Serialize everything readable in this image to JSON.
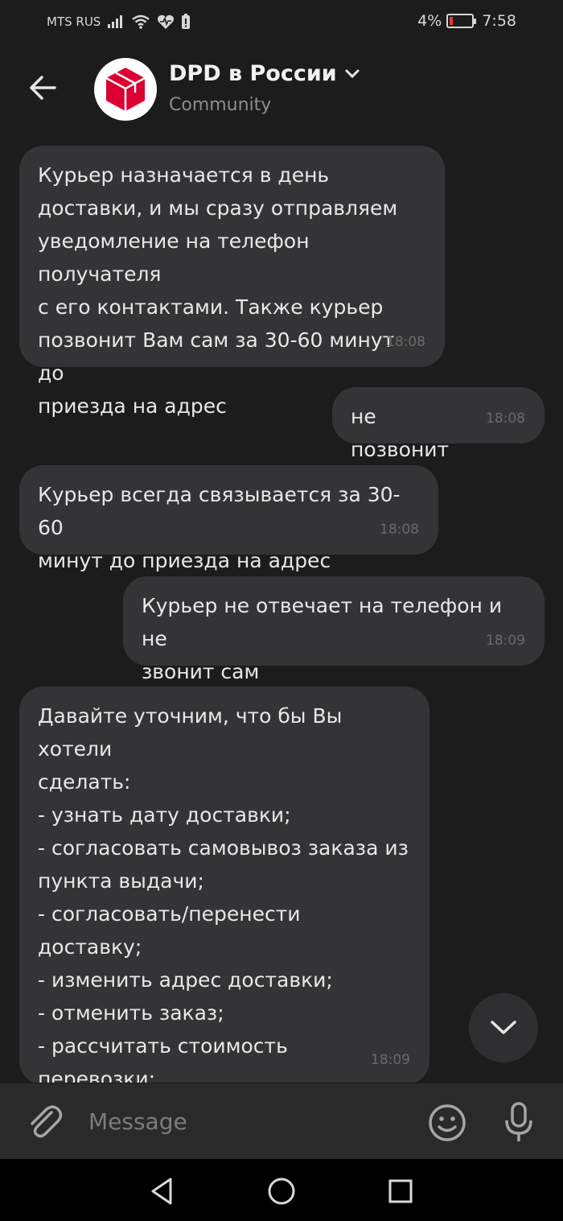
{
  "status": {
    "carrier": "MTS RUS",
    "battery": "4%",
    "time": "7:58",
    "icons": [
      "signal-icon",
      "wifi-icon",
      "health-icon",
      "notification-icon"
    ]
  },
  "header": {
    "title": "DPD в России",
    "subtitle": "Community",
    "brand_color": "#dc0032"
  },
  "messages": [
    {
      "side": "in",
      "text": "Курьер назначается в день\nдоставки, и мы сразу отправляем\nуведомление на телефон получателя\nс его контактами. Также курьер\nпозвонит Вам сам за 30-60 минут до\nприезда на адрес",
      "time": "18:08"
    },
    {
      "side": "out",
      "text": "не позвонит",
      "time": "18:08"
    },
    {
      "side": "in",
      "text": "Курьер всегда связывается за 30-60\nминут до приезда на адрес",
      "time": "18:08"
    },
    {
      "side": "out",
      "text": "Курьер не отвечает на телефон и не\nзвонит сам",
      "time": "18:09"
    },
    {
      "side": "in",
      "text": "Давайте уточним, что бы Вы хотели\nсделать:\n- узнать дату доставки;\n- согласовать самовывоз заказа из\nпункта выдачи;\n- согласовать/перенести доставку;\n- изменить адрес доставки;\n- отменить заказ;\n- рассчитать стоимость перевозки;\n- оформить заказ;\n- стать клиентом DPD (для юр.лиц).",
      "time": "18:09"
    }
  ],
  "composer": {
    "placeholder": "Message"
  },
  "colors": {
    "background": "#1c1c1d",
    "bubble": "#343436",
    "composer": "#2a2a2b"
  }
}
